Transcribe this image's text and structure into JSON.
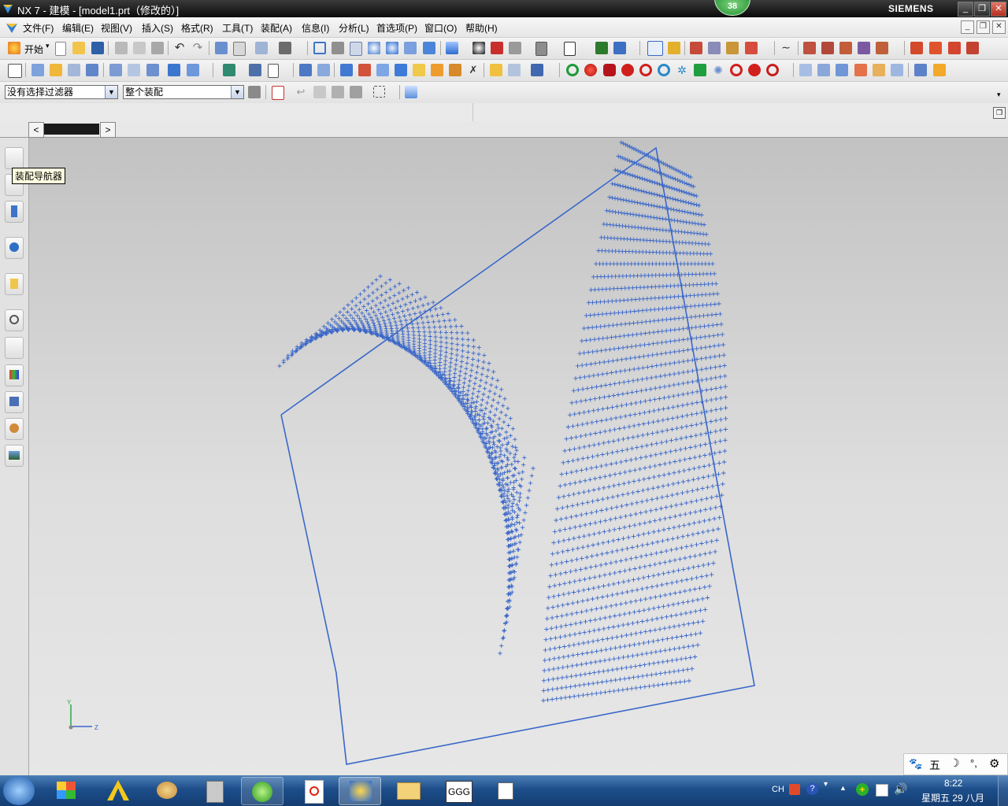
{
  "window": {
    "title": "NX 7 - 建模 - [model1.prt（修改的）]",
    "badge_count": "38",
    "brand": "SIEMENS"
  },
  "menu": {
    "items": [
      "文件(F)",
      "编辑(E)",
      "视图(V)",
      "插入(S)",
      "格式(R)",
      "工具(T)",
      "装配(A)",
      "信息(I)",
      "分析(L)",
      "首选项(P)",
      "窗口(O)",
      "帮助(H)"
    ]
  },
  "toolbar": {
    "start_label": "开始"
  },
  "selection_bar": {
    "filter_value": "没有选择过滤器",
    "scope_value": "整个装配"
  },
  "resource_bar": {
    "tooltip": "装配导航器"
  },
  "viewport": {
    "triad_y": "Y",
    "triad_z": "Z",
    "curve_color": "#3a67c9"
  },
  "ime": {
    "mode_label": "五"
  },
  "taskbar": {
    "lang": "CH",
    "time": "8:22",
    "date": "星期五 29 八月"
  }
}
